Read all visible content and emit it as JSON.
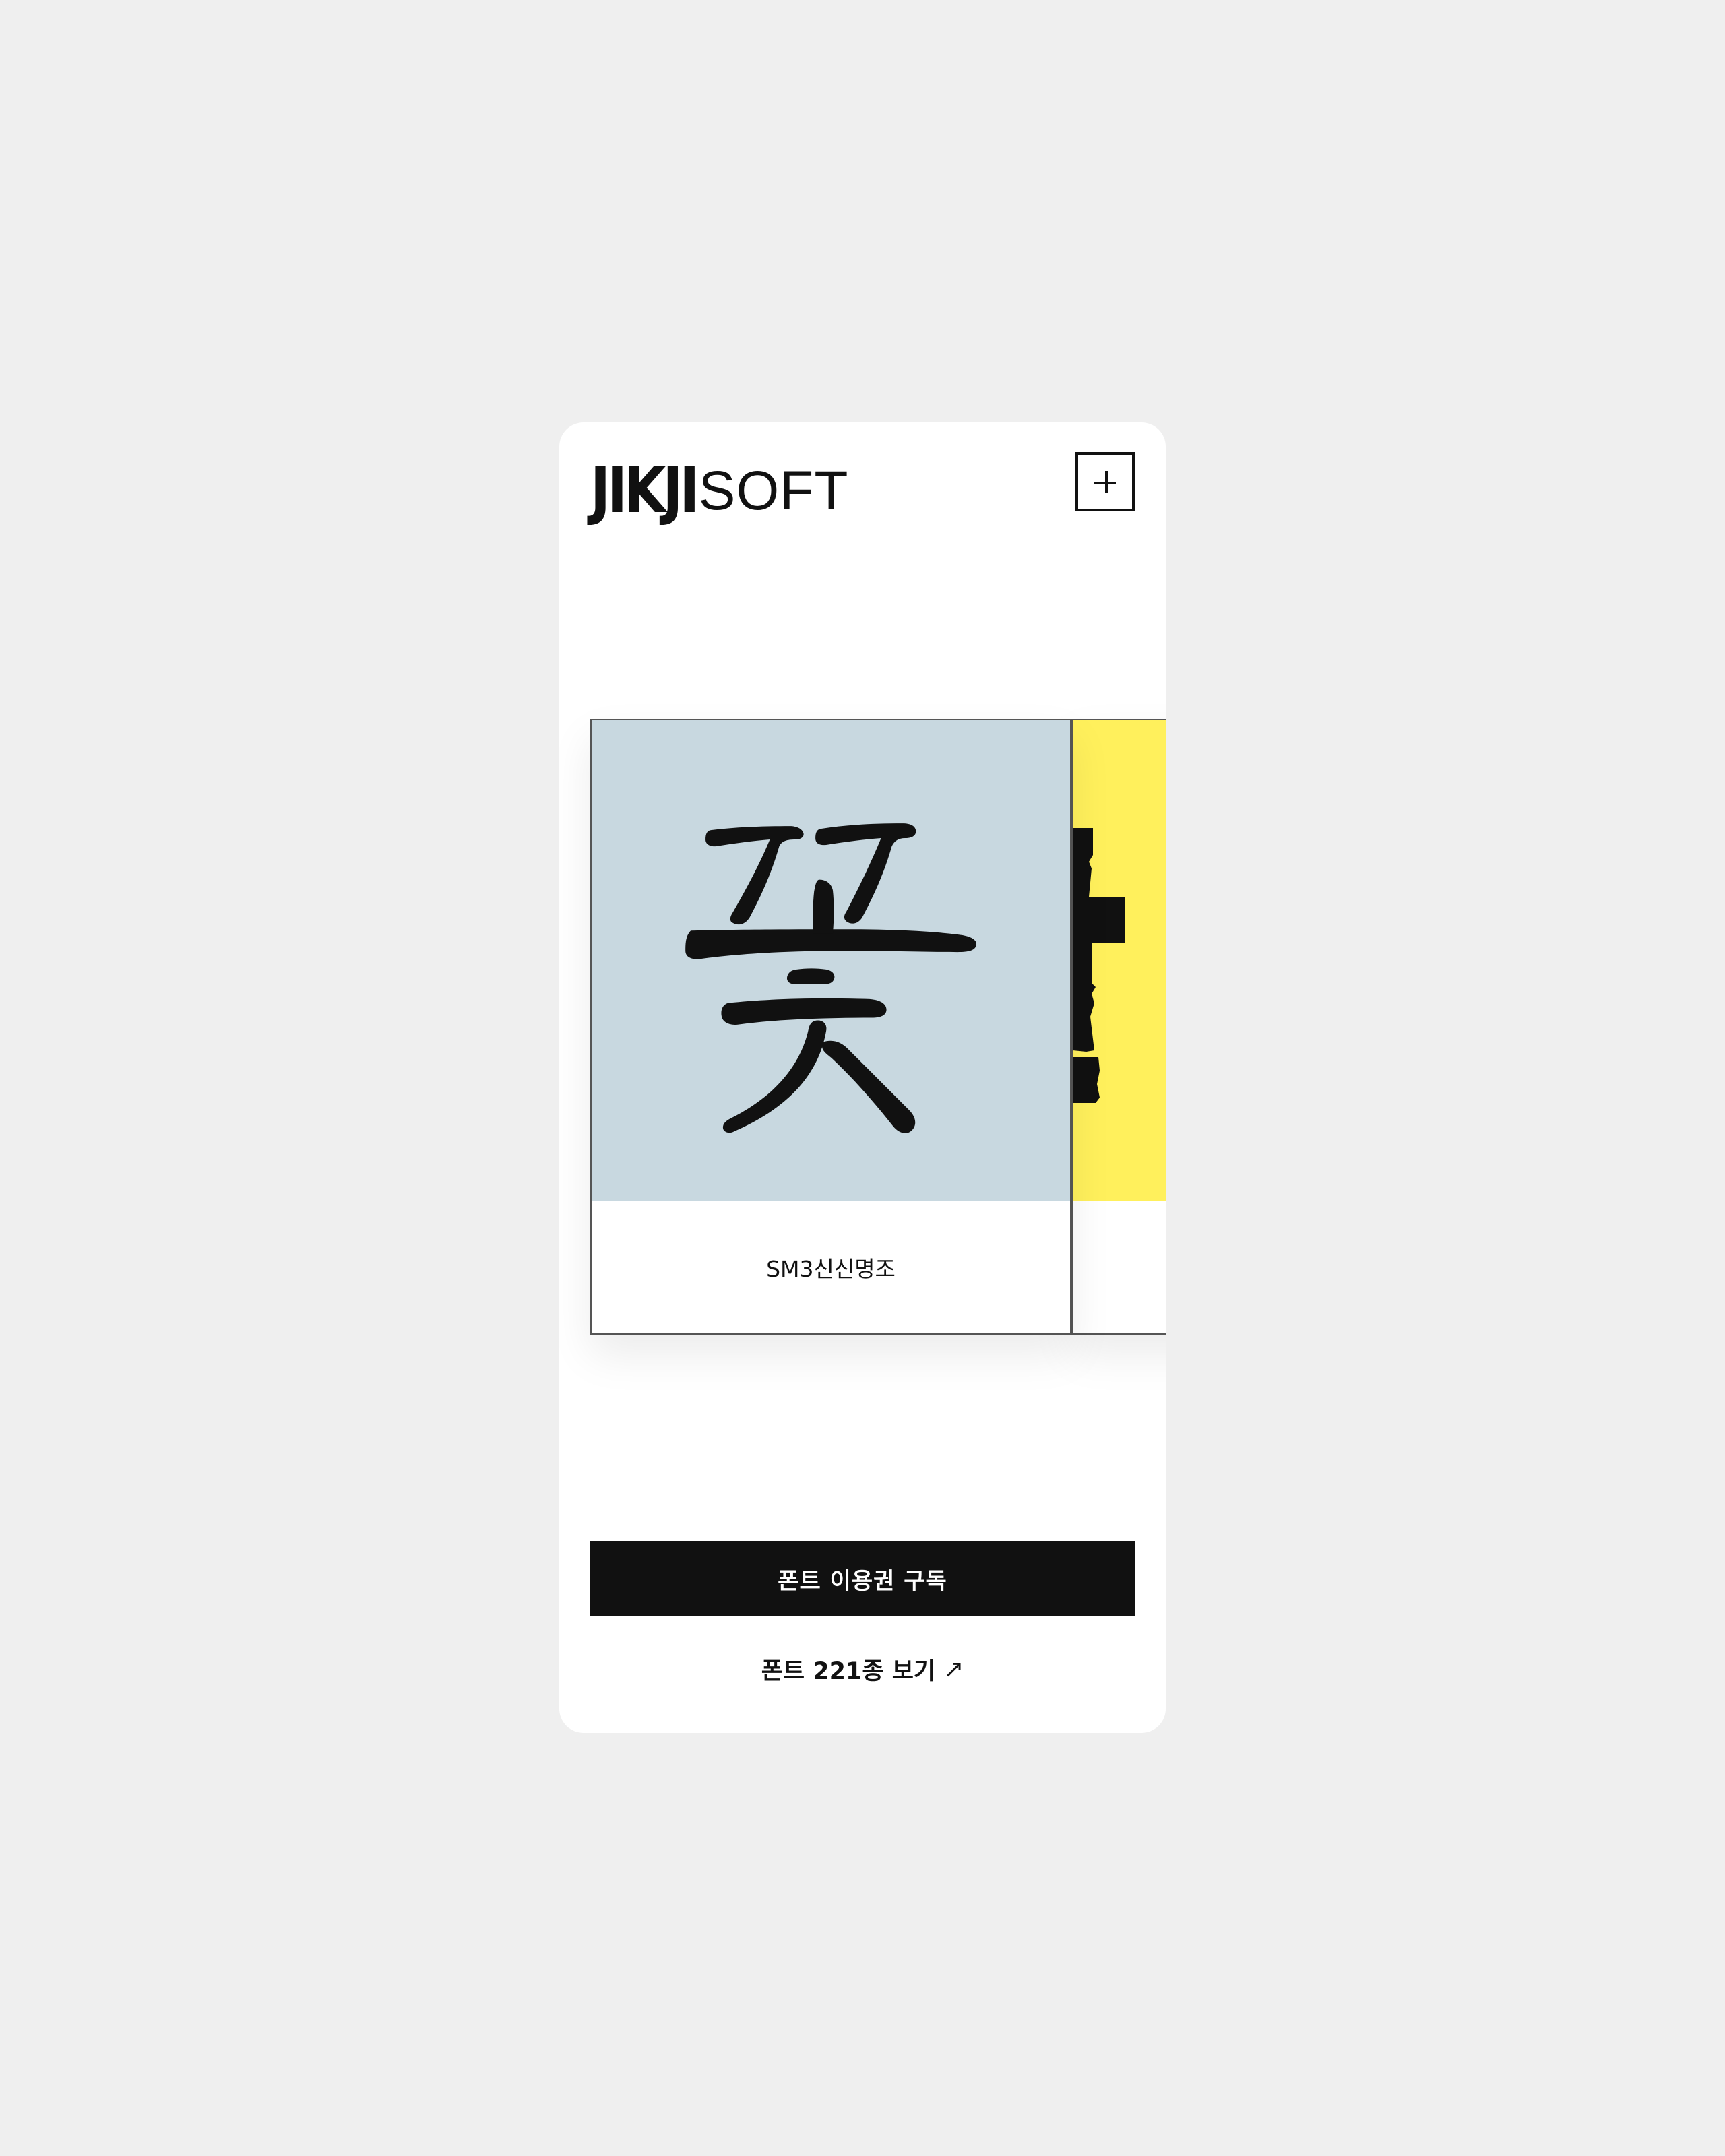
{
  "brand": {
    "logo_bold": "JIKJI",
    "logo_light": "SOFT"
  },
  "header": {
    "menu_icon": "plus-icon"
  },
  "carousel": {
    "cards": [
      {
        "glyph": "꽃",
        "name": "SM3신신명조",
        "background": "#c8d8e0"
      },
      {
        "glyph": "",
        "name": "",
        "background": "#fff05c"
      }
    ]
  },
  "actions": {
    "subscribe_label": "폰트 이용권 구독",
    "view_fonts_label": "폰트 221종 보기",
    "view_fonts_icon": "arrow-up-right-icon"
  },
  "colors": {
    "page_background": "#efefef",
    "panel_background": "#ffffff",
    "primary_button": "#111111",
    "primary_button_text": "#ffffff"
  }
}
